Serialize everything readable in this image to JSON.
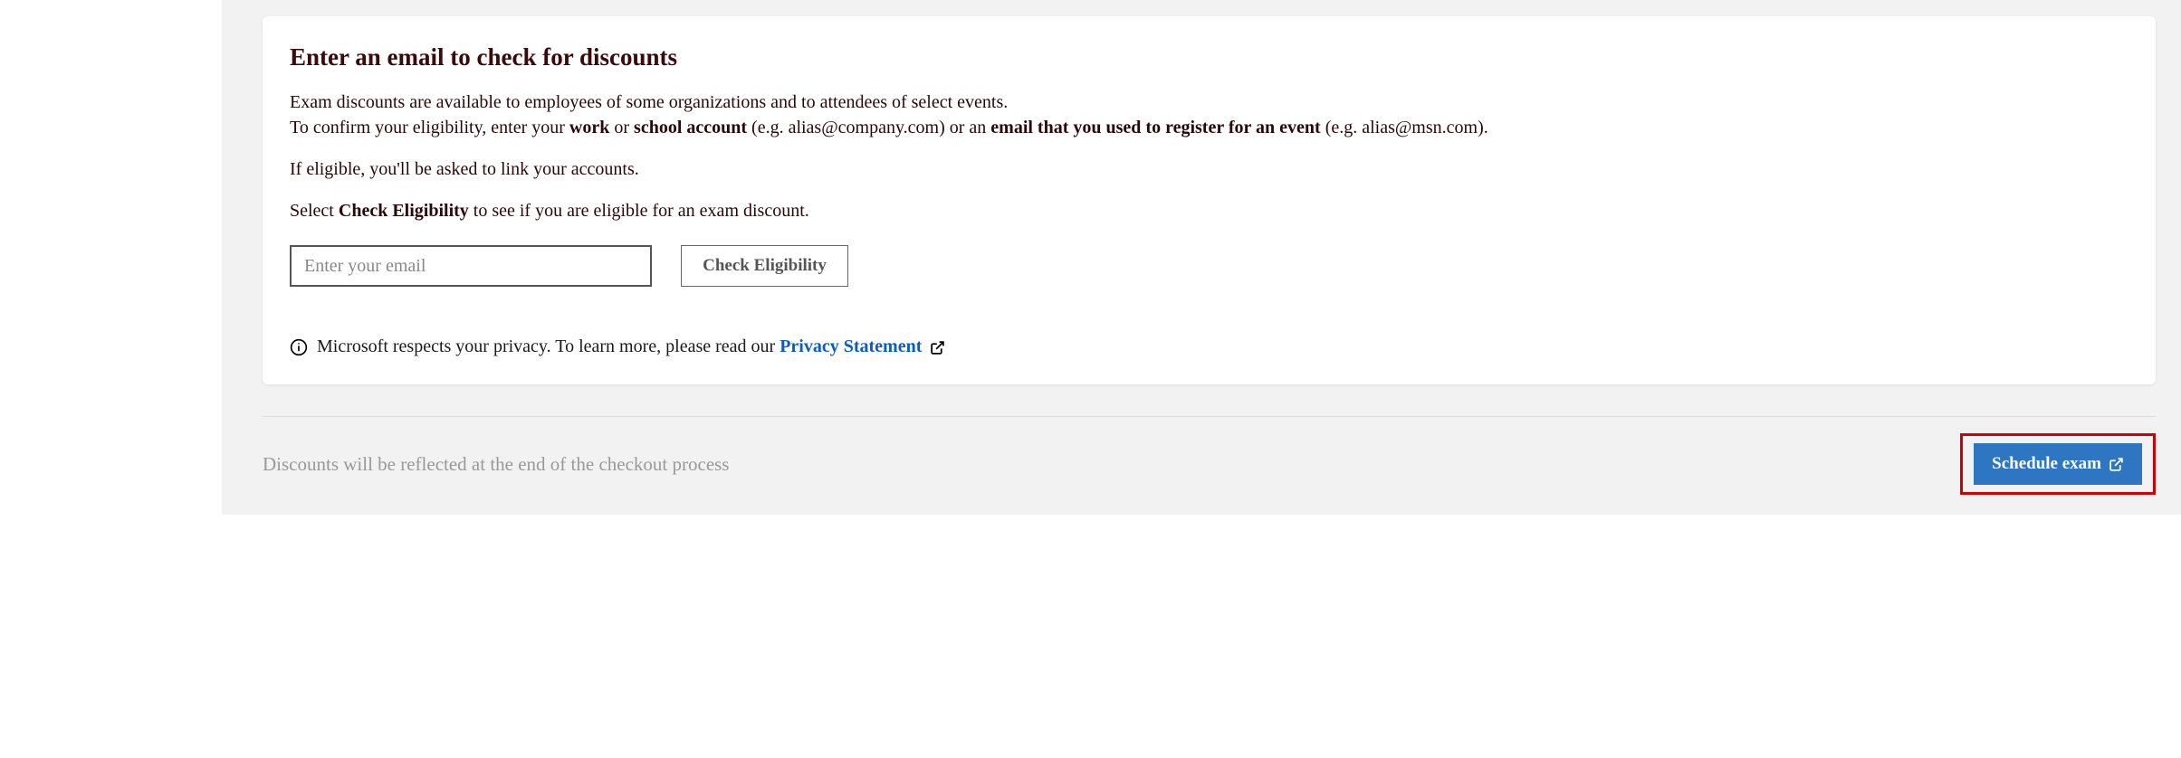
{
  "card": {
    "title": "Enter an email to check for discounts",
    "desc1": "Exam discounts are available to employees of some organizations and to attendees of select events.",
    "desc2_pre": "To confirm your eligibility, enter your ",
    "desc2_work": "work",
    "desc2_or": " or ",
    "desc2_school": "school account",
    "desc2_eg1": " (e.g. alias@company.com) or an ",
    "desc2_evt": "email that you used to register for an event",
    "desc2_eg2": " (e.g. alias@msn.com).",
    "desc3": "If eligible, you'll be asked to link your accounts.",
    "desc4_pre": "Select ",
    "desc4_bold": "Check Eligibility",
    "desc4_post": " to see if you are eligible for an exam discount.",
    "email_placeholder": "Enter your email",
    "check_btn": "Check Eligibility",
    "privacy_text": "Microsoft respects your privacy. To learn more, please read our ",
    "privacy_link": "Privacy Statement"
  },
  "footer": {
    "note": "Discounts will be reflected at the end of the checkout process",
    "schedule_btn": "Schedule exam"
  }
}
